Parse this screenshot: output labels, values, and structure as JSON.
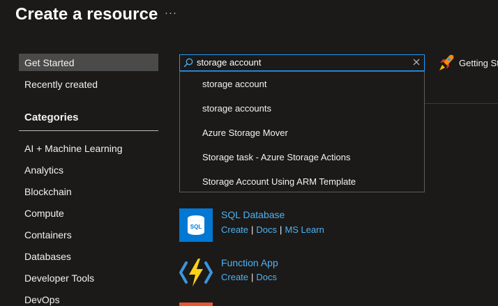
{
  "header": {
    "title": "Create a resource",
    "more": "···"
  },
  "sidebar": {
    "items": [
      {
        "label": "Get Started"
      },
      {
        "label": "Recently created"
      }
    ],
    "categories_heading": "Categories",
    "categories": [
      "AI + Machine Learning",
      "Analytics",
      "Blockchain",
      "Compute",
      "Containers",
      "Databases",
      "Developer Tools",
      "DevOps"
    ]
  },
  "search": {
    "value": "storage account",
    "suggestions": [
      "storage account",
      "storage accounts",
      "Azure Storage Mover",
      "Storage task - Azure Storage Actions",
      "Storage Account Using ARM Template"
    ]
  },
  "getting_started": {
    "label": "Getting St"
  },
  "services": [
    {
      "title": "SQL Database",
      "icon": "sql-database-icon",
      "icon_text": "SQL",
      "links": [
        "Create",
        "Docs",
        "MS Learn"
      ]
    },
    {
      "title": "Function App",
      "icon": "function-app-icon",
      "links": [
        "Create",
        "Docs"
      ]
    }
  ],
  "colors": {
    "accent": "#2899f5",
    "link": "#4fb2f2",
    "background": "#1b1a19",
    "active_nav": "#4a4a4a",
    "sql_tile": "#0078d4",
    "bolt": "#fcd116"
  }
}
